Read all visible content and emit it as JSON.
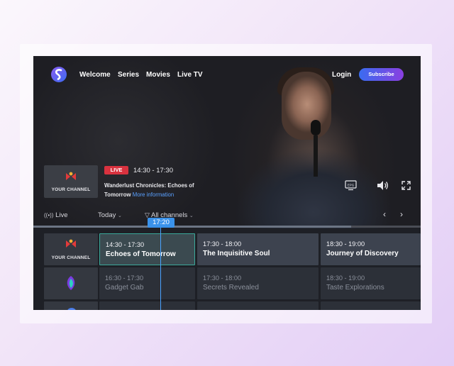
{
  "nav": {
    "links": [
      "Welcome",
      "Series",
      "Movies",
      "Live TV"
    ],
    "login_label": "Login",
    "subscribe_label": "Subscribe"
  },
  "now_playing": {
    "channel": "YOUR CHANNEL",
    "badge": "LIVE",
    "time": "14:30 - 17:30",
    "title": "Wanderlust Chronicles: Echoes of Tomorrow",
    "more_info": "More information",
    "controls": [
      "epg-icon",
      "volume-icon",
      "fullscreen-icon"
    ],
    "epg_label": "EPG"
  },
  "filters": {
    "live": "Live",
    "day": "Today",
    "channels": "All channels"
  },
  "current_time": "17:20",
  "progress": 0.82,
  "epg": {
    "rows": [
      {
        "channel": "YOUR CHANNEL",
        "programs": [
          {
            "time": "14:30 - 17:30",
            "title": "Echoes of Tomorrow"
          },
          {
            "time": "17:30 - 18:00",
            "title": "The Inquisitive Soul"
          },
          {
            "time": "18:30 - 19:00",
            "title": "Journey of Discovery"
          }
        ]
      },
      {
        "channel": "",
        "programs": [
          {
            "time": "16:30 - 17:30",
            "title": "Gadget Gab"
          },
          {
            "time": "17:30 - 18:00",
            "title": "Secrets Revealed"
          },
          {
            "time": "18:30 - 19:00",
            "title": "Taste Explorations"
          }
        ]
      }
    ]
  },
  "colors": {
    "accent_blue": "#3a92ea",
    "live_red": "#d9323f",
    "subscribe_gradient": [
      "#3a6cf0",
      "#8a3fe0"
    ]
  }
}
